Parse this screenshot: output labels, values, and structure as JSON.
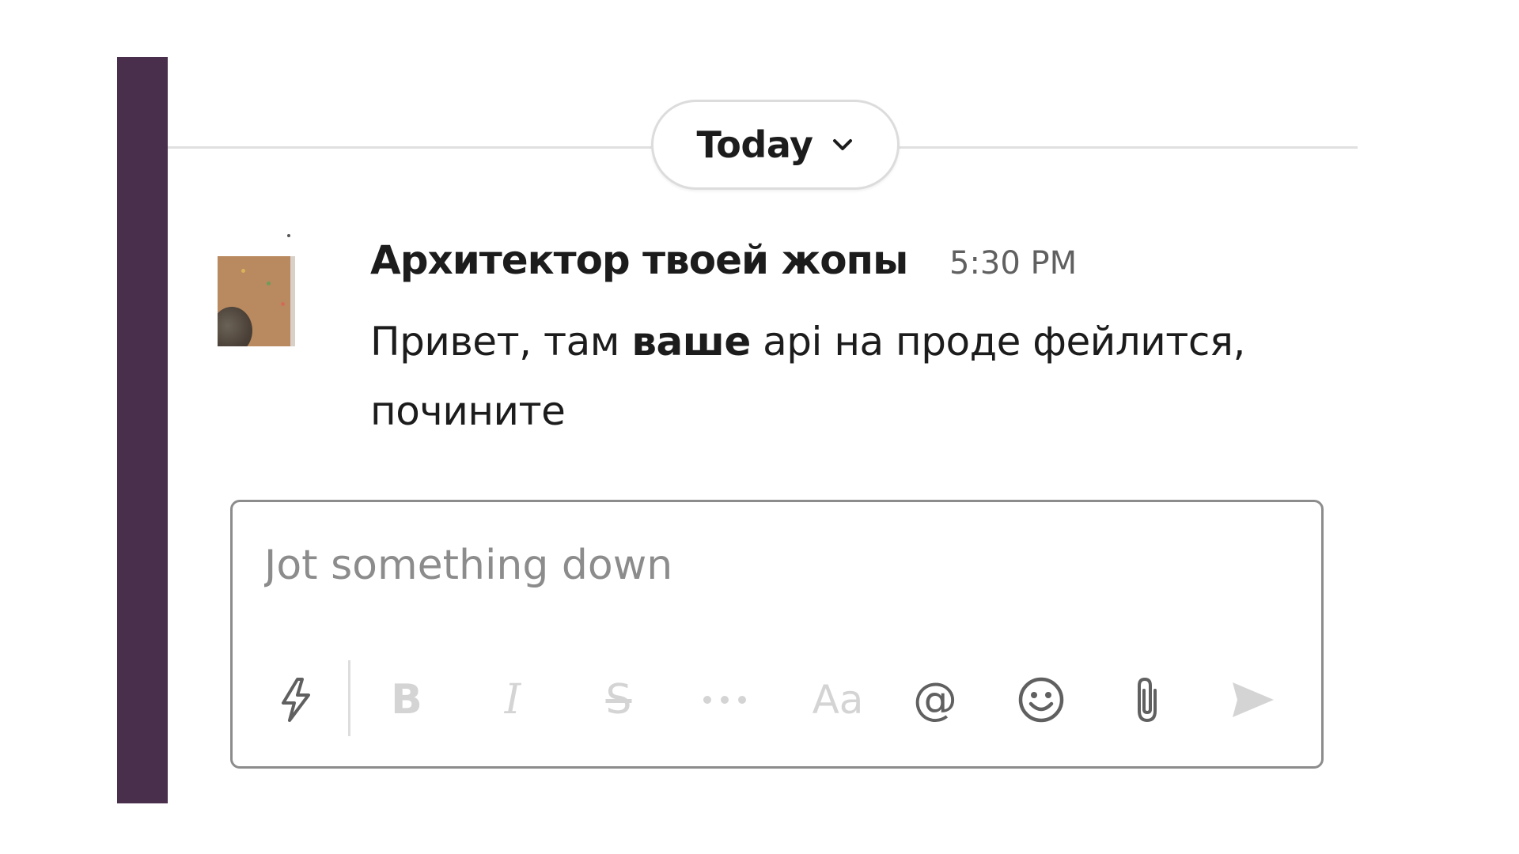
{
  "divider": {
    "label": "Today"
  },
  "message": {
    "sender": "Архитектор твоей жопы",
    "time": "5:30 PM",
    "text_before": "Привет, там ",
    "text_bold": "ваше",
    "text_after": " api на проде фейлится, почините"
  },
  "composer": {
    "placeholder": "Jot something down",
    "value": "",
    "toolbar": [
      {
        "icon": "lightning-icon",
        "enabled": true
      },
      {
        "icon": "bold-icon",
        "label": "B",
        "enabled": false
      },
      {
        "icon": "italic-icon",
        "label": "I",
        "enabled": false
      },
      {
        "icon": "strikethrough-icon",
        "label": "S",
        "enabled": false
      },
      {
        "icon": "more-icon",
        "enabled": false
      },
      {
        "icon": "text-format-icon",
        "label": "Aa",
        "enabled": false
      },
      {
        "icon": "mention-icon",
        "label": "@",
        "enabled": true
      },
      {
        "icon": "emoji-icon",
        "enabled": true
      },
      {
        "icon": "attach-icon",
        "enabled": true
      },
      {
        "icon": "send-icon",
        "enabled": false
      }
    ]
  },
  "colors": {
    "sidebar": "#4a2f4d",
    "text": "#1d1c1d",
    "muted": "#616061",
    "disabled_icon": "#d4d4d4",
    "active_icon": "#616061",
    "border": "#8c8c8c"
  }
}
